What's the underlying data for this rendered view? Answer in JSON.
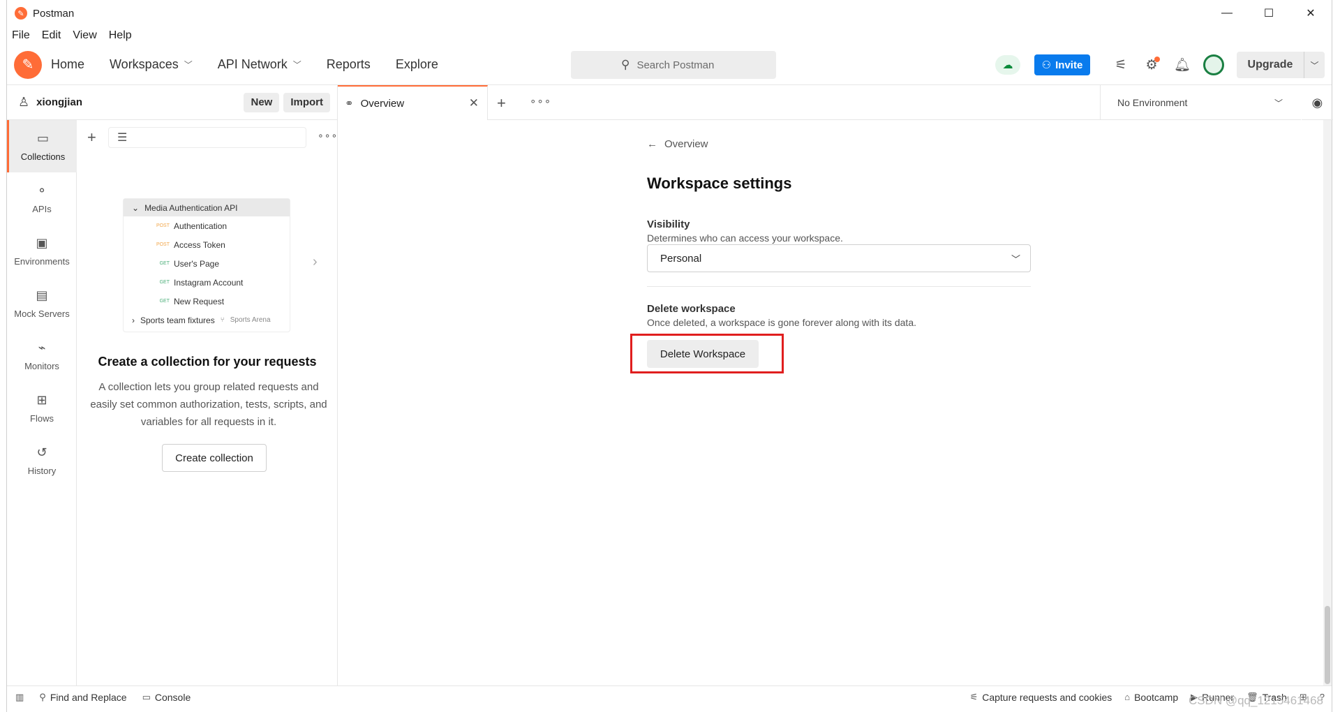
{
  "window": {
    "title": "Postman",
    "controls": [
      "—",
      "☐",
      "✕"
    ]
  },
  "menu": [
    "File",
    "Edit",
    "View",
    "Help"
  ],
  "header": {
    "nav": [
      {
        "label": "Home"
      },
      {
        "label": "Workspaces"
      },
      {
        "label": "API Network"
      },
      {
        "label": "Reports"
      },
      {
        "label": "Explore"
      }
    ],
    "search_placeholder": "Search Postman",
    "invite_label": "Invite",
    "upgrade_label": "Upgrade",
    "brand_color": "#ff6c37",
    "invite_color": "#097bed"
  },
  "workspace_bar": {
    "user": "xiongjian",
    "new_label": "New",
    "import_label": "Import"
  },
  "tabs": {
    "active_tab": "Overview",
    "environment": "No Environment"
  },
  "rail": [
    {
      "label": "Collections",
      "icon": "collections-icon"
    },
    {
      "label": "APIs",
      "icon": "apis-icon"
    },
    {
      "label": "Environments",
      "icon": "environments-icon"
    },
    {
      "label": "Mock Servers",
      "icon": "mock-servers-icon"
    },
    {
      "label": "Monitors",
      "icon": "monitors-icon"
    },
    {
      "label": "Flows",
      "icon": "flows-icon"
    },
    {
      "label": "History",
      "icon": "history-icon"
    }
  ],
  "sidebar": {
    "preview": {
      "collection": "Media Authentication API",
      "requests": [
        {
          "method": "POST",
          "name": "Authentication"
        },
        {
          "method": "POST",
          "name": "Access Token"
        },
        {
          "method": "GET",
          "name": "User's Page"
        },
        {
          "method": "GET",
          "name": "Instagram Account"
        },
        {
          "method": "GET",
          "name": "New Request"
        }
      ],
      "footer_collection": "Sports team fixtures",
      "footer_workspace": "Sports Arena"
    },
    "empty_title": "Create a collection for your requests",
    "empty_desc": "A collection lets you group related requests and easily set common authorization, tests, scripts, and variables for all requests in it.",
    "create_label": "Create collection"
  },
  "main": {
    "back_label": "Overview",
    "title": "Workspace settings",
    "visibility_title": "Visibility",
    "visibility_desc": "Determines who can access your workspace.",
    "visibility_value": "Personal",
    "delete_title": "Delete workspace",
    "delete_desc": "Once deleted, a workspace is gone forever along with its data.",
    "delete_label": "Delete Workspace",
    "highlight_color": "#e01e1e"
  },
  "statusbar": {
    "find": "Find and Replace",
    "console": "Console",
    "capture": "Capture requests and cookies",
    "bootcamp": "Bootcamp",
    "runner": "Runner",
    "trash": "Trash"
  },
  "watermark": "CSDN @qq_1215461468"
}
